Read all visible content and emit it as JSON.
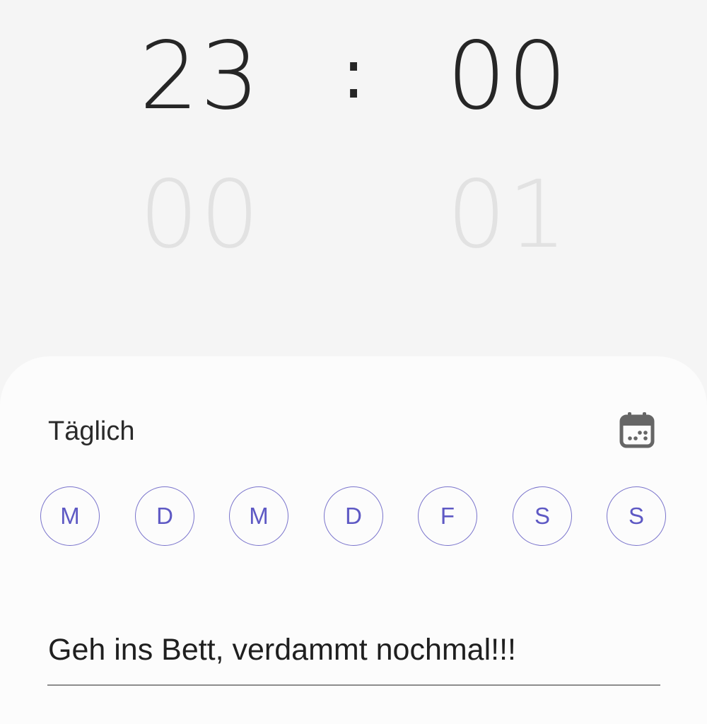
{
  "time_picker": {
    "hour_selected": "23",
    "hour_next": "00",
    "separator": ":",
    "minute_selected": "00",
    "minute_next": "01"
  },
  "repeat": {
    "label": "Täglich",
    "calendar_icon": "calendar-icon",
    "days": [
      "M",
      "D",
      "M",
      "D",
      "F",
      "S",
      "S"
    ]
  },
  "alarm_name": {
    "value": "Geh ins Bett, verdammt nochmal!!!"
  },
  "colors": {
    "accent": "#5e59c4",
    "text_primary": "#262626",
    "text_faded": "#e2e2e2",
    "sheet_background": "#fcfcfc",
    "page_background": "#f5f5f5"
  }
}
